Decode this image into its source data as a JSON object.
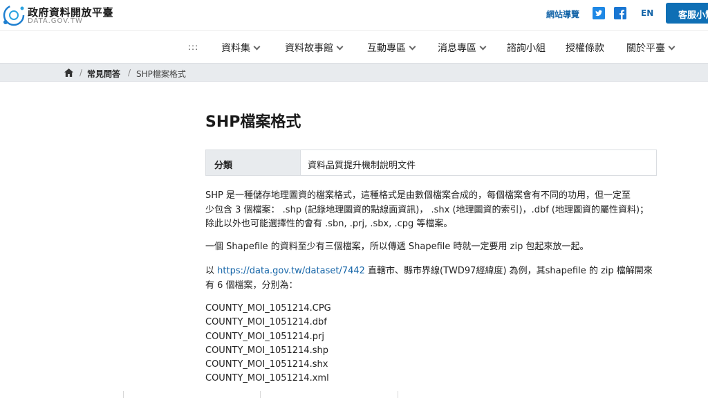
{
  "header": {
    "site_name": "政府資料開放平臺",
    "site_url": "DATA.GOV.TW",
    "sitemap": "網站導覽",
    "language": "EN",
    "service_button": "客服小幫手",
    "colors": {
      "accent": "#0f6fb5",
      "link": "#1565a8"
    }
  },
  "nav": {
    "grid": ":::",
    "items": [
      {
        "label": "資料集",
        "dropdown": true
      },
      {
        "label": "資料故事館",
        "dropdown": true
      },
      {
        "label": "互動專區",
        "dropdown": true
      },
      {
        "label": "消息專區",
        "dropdown": true
      },
      {
        "label": "諮詢小組",
        "dropdown": false
      },
      {
        "label": "授權條款",
        "dropdown": false
      },
      {
        "label": "關於平臺",
        "dropdown": true
      }
    ]
  },
  "breadcrumb": {
    "home_icon": "home-icon",
    "sep": "/",
    "faq": "常見問答",
    "current": "SHP檔案格式"
  },
  "article": {
    "title": "SHP檔案格式",
    "category_label": "分類",
    "category_value": "資料品質提升機制說明文件",
    "para1_lines": [
      "SHP 是一種儲存地理圖資的檔案格式，這種格式是由數個檔案合成的，每個檔案會有不同的功用，但一定至",
      "少包含 3 個檔案： .shp (記錄地理圖資的點線面資訊)， .shx (地理圖資的索引)，.dbf (地理圖資的屬性資料)；",
      "除此以外也可能選擇性的會有 .sbn, .prj, .sbx, .cpg 等檔案。"
    ],
    "para2": "一個 Shapefile 的資料至少有三個檔案，所以傳遞 Shapefile 時就一定要用 zip 包起來放一起。",
    "para3_prefix": "以 ",
    "para3_link": "https://data.gov.tw/dataset/7442",
    "para3_suffix": " 直轄市、縣市界線(TWD97經緯度) 為例，其shapefile 的 zip 檔解開來",
    "para3_line2": "有 6 個檔案，分別為：",
    "files": [
      "COUNTY_MOI_1051214.CPG",
      "COUNTY_MOI_1051214.dbf",
      "COUNTY_MOI_1051214.prj",
      "COUNTY_MOI_1051214.shp",
      "COUNTY_MOI_1051214.shx",
      "COUNTY_MOI_1051214.xml"
    ]
  }
}
